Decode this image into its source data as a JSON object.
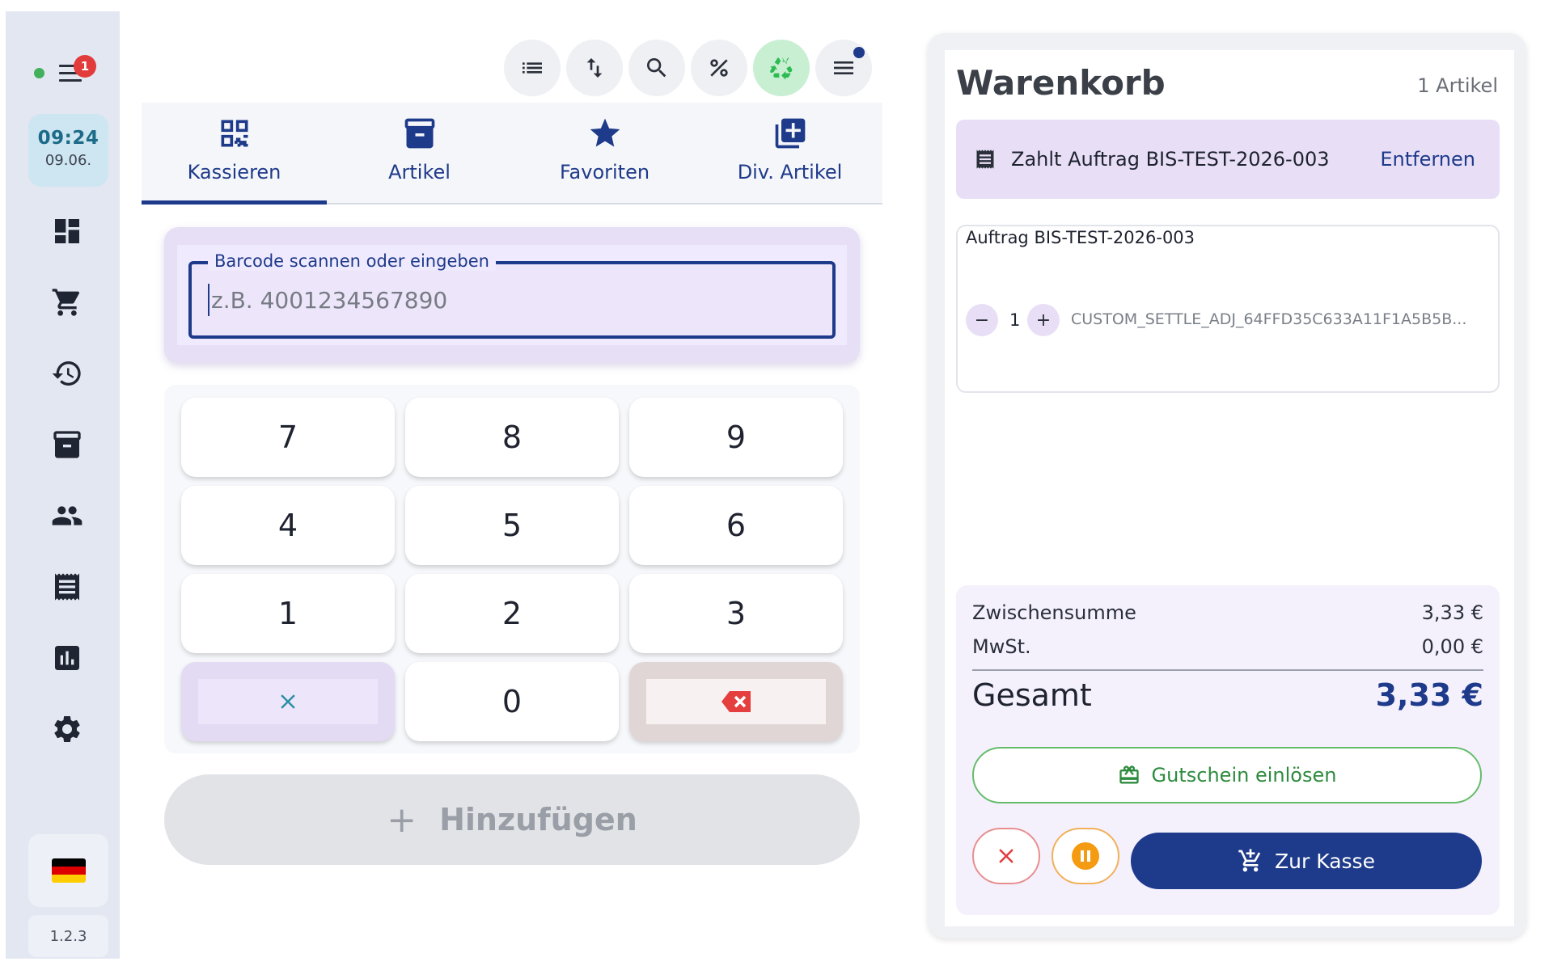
{
  "sidebar": {
    "status_color": "#43b05c",
    "notification_count": "1",
    "clock_time": "09:24",
    "clock_date": "09.06.",
    "nav_icons": [
      "dashboard-icon",
      "cart-icon",
      "history-icon",
      "archive-icon",
      "customers-icon",
      "receipt-icon",
      "reports-icon",
      "settings-icon"
    ],
    "language_flag": "de-flag-icon",
    "version": "1.2.3"
  },
  "toolbar": {
    "icons": [
      "list-icon",
      "sort-icon",
      "search-icon",
      "percent-icon",
      "recycle-icon",
      "menu-icon"
    ],
    "accent_color": "#1e3a8a"
  },
  "tabs": [
    {
      "label": "Kassieren",
      "icon": "qr-code-icon",
      "active": true
    },
    {
      "label": "Artikel",
      "icon": "archive-icon",
      "active": false
    },
    {
      "label": "Favoriten",
      "icon": "star-icon",
      "active": false
    },
    {
      "label": "Div. Artikel",
      "icon": "add-box-icon",
      "active": false
    }
  ],
  "barcode": {
    "label": "Barcode scannen oder eingeben",
    "placeholder": "z.B. 4001234567890",
    "value": ""
  },
  "keypad": {
    "keys": [
      "7",
      "8",
      "9",
      "4",
      "5",
      "6",
      "1",
      "2",
      "3",
      "0"
    ],
    "clear_icon": "close-icon",
    "backspace_icon": "backspace-icon"
  },
  "add_button": {
    "label": "Hinzufügen",
    "icon": "+"
  },
  "cart": {
    "title": "Warenkorb",
    "count": "1 Artikel",
    "order_banner": {
      "text": "Zahlt Auftrag BIS-TEST-2026-003",
      "remove_label": "Entfernen"
    },
    "items": [
      {
        "title": "Auftrag BIS-TEST-2026-003",
        "quantity": "1",
        "code": "CUSTOM_SETTLE_ADJ_64FFD35C633A11F1A5B5B..."
      }
    ],
    "subtotal_label": "Zwischensumme",
    "subtotal_value": "3,33 €",
    "tax_label": "MwSt.",
    "tax_value": "0,00 €",
    "total_label": "Gesamt",
    "total_value": "3,33 €",
    "voucher_label": "Gutschein einlösen",
    "checkout_label": "Zur Kasse"
  }
}
